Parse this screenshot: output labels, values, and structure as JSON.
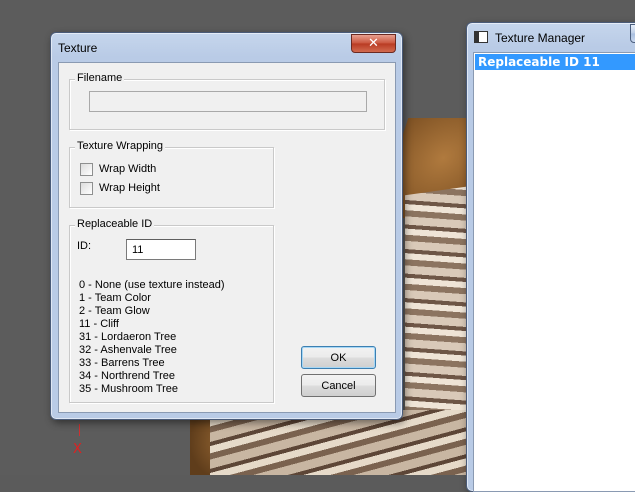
{
  "viewport": {
    "axis_label": "X"
  },
  "texture_dialog": {
    "title": "Texture",
    "close_glyph": "✕",
    "filename": {
      "label": "Filename",
      "value": ""
    },
    "texture_wrapping": {
      "label": "Texture Wrapping",
      "wrap_width": {
        "label": "Wrap Width",
        "checked": false
      },
      "wrap_height": {
        "label": "Wrap Height",
        "checked": false
      }
    },
    "replaceable_id": {
      "label": "Replaceable ID",
      "id_label": "ID:",
      "id_value": "11",
      "options": [
        "0 - None (use texture instead)",
        "1 - Team Color",
        "2 - Team Glow",
        "11 - Cliff",
        "31 - Lordaeron Tree",
        "32 - Ashenvale Tree",
        "33 - Barrens Tree",
        "34 - Northrend Tree",
        "35 - Mushroom Tree"
      ]
    },
    "ok_label": "OK",
    "cancel_label": "Cancel"
  },
  "texture_manager": {
    "title": "Texture Manager",
    "items": [
      {
        "label": "Replaceable ID 11",
        "selected": true
      }
    ]
  }
}
